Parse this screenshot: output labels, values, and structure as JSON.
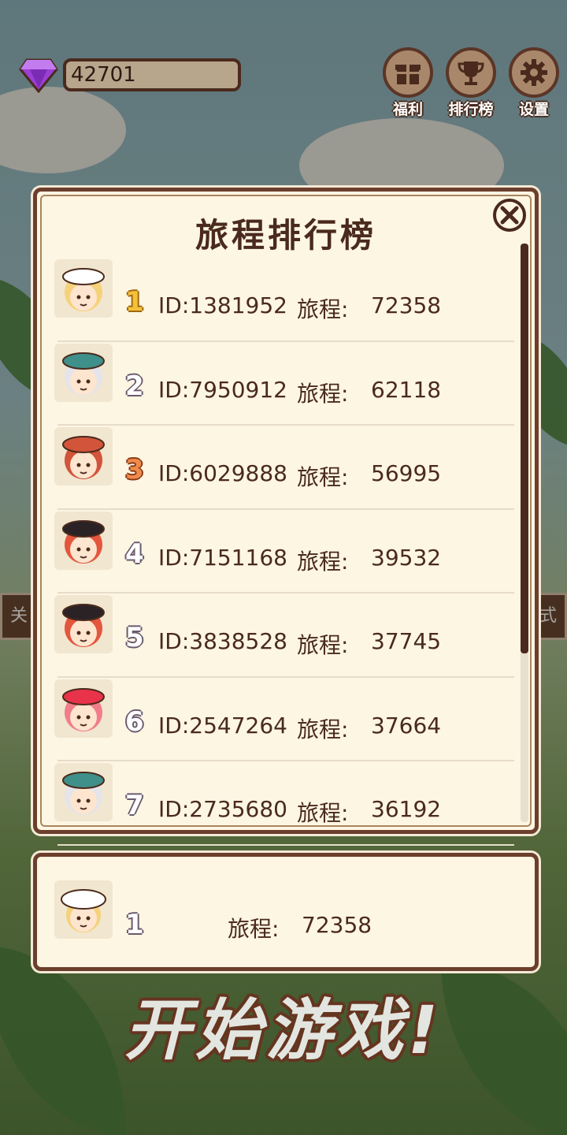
{
  "currency": {
    "icon": "gem-icon",
    "value": "42701"
  },
  "top_buttons": [
    {
      "label": "福利",
      "icon": "gift-icon"
    },
    {
      "label": "排行榜",
      "icon": "trophy-icon"
    },
    {
      "label": "设置",
      "icon": "gear-icon"
    }
  ],
  "background": {
    "left_tab": "关",
    "right_tab": "式"
  },
  "leaderboard": {
    "title": "旅程排行榜",
    "distance_label": "旅程:",
    "rows": [
      {
        "rank": "1",
        "id": "ID:1381952",
        "distance": "72358",
        "avatar": "white-cap-blonde-avatar"
      },
      {
        "rank": "2",
        "id": "ID:7950912",
        "distance": "62118",
        "avatar": "silver-hair-headband-avatar"
      },
      {
        "rank": "3",
        "id": "ID:6029888",
        "distance": "56995",
        "avatar": "red-hair-skull-avatar"
      },
      {
        "rank": "4",
        "id": "ID:7151168",
        "distance": "39532",
        "avatar": "cat-hood-avatar"
      },
      {
        "rank": "5",
        "id": "ID:3838528",
        "distance": "37745",
        "avatar": "cat-hood-wink-avatar"
      },
      {
        "rank": "6",
        "id": "ID:2547264",
        "distance": "37664",
        "avatar": "pink-hair-bow-avatar"
      },
      {
        "rank": "7",
        "id": "ID:2735680",
        "distance": "36192",
        "avatar": "silver-hair-headband-avatar"
      }
    ]
  },
  "my_rank": {
    "rank": "1",
    "distance_label": "旅程:",
    "distance": "72358",
    "avatar": "white-cap-blonde-avatar"
  },
  "start_button": {
    "label": "开始游戏!"
  },
  "colors": {
    "panel_bg": "#fdf6e3",
    "border": "#6b3f2c",
    "text": "#4a2a1c",
    "gold": "#f5c13a",
    "bronze": "#f08a4b"
  }
}
